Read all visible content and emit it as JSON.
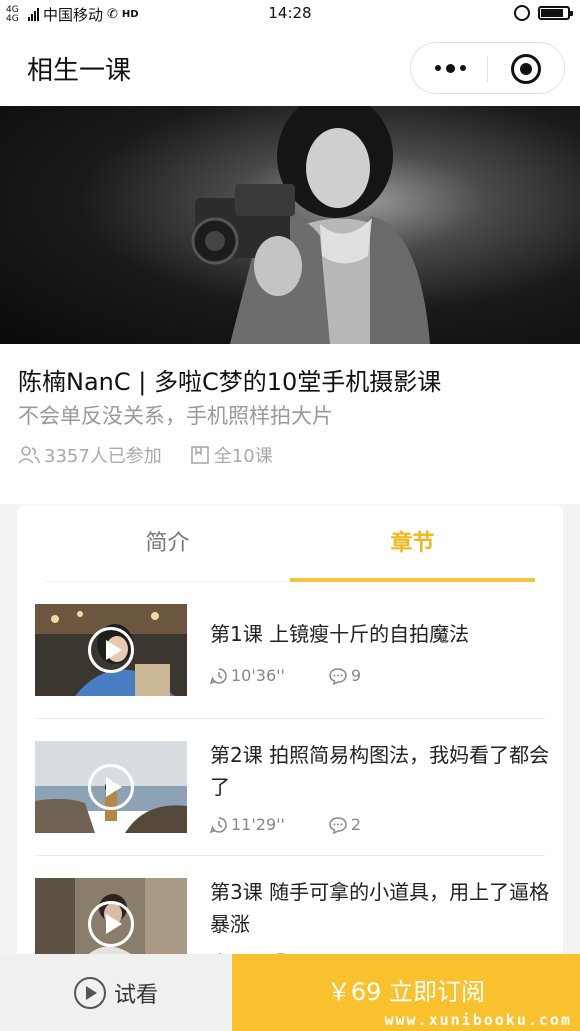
{
  "status_bar": {
    "network": "4G 4G",
    "carrier": "中国移动",
    "hd": "HD",
    "time": "14:28"
  },
  "nav": {
    "title": "相生一课"
  },
  "course": {
    "title": "陈楠NanC | 多啦C梦的10堂手机摄影课",
    "subtitle": "不会单反没关系，手机照样拍大片",
    "participants": "3357人已参加",
    "lessons_total": "全10课"
  },
  "tabs": [
    {
      "label": "简介",
      "active": false
    },
    {
      "label": "章节",
      "active": true
    }
  ],
  "lessons": [
    {
      "title": "第1课 上镜瘦十斤的自拍魔法",
      "duration": "10'36''",
      "comments": "9"
    },
    {
      "title": "第2课 拍照简易构图法，我妈看了都会了",
      "duration": "11'29''",
      "comments": "2"
    },
    {
      "title": "第3课 随手可拿的小道具，用上了逼格暴涨",
      "duration": "",
      "comments": ""
    }
  ],
  "bottom": {
    "trial_label": "试看",
    "subscribe_label": "￥69 立即订阅",
    "watermark": "www.xunibooku.com"
  },
  "colors": {
    "accent": "#f9c12e",
    "tab_active": "#f2b71e"
  }
}
